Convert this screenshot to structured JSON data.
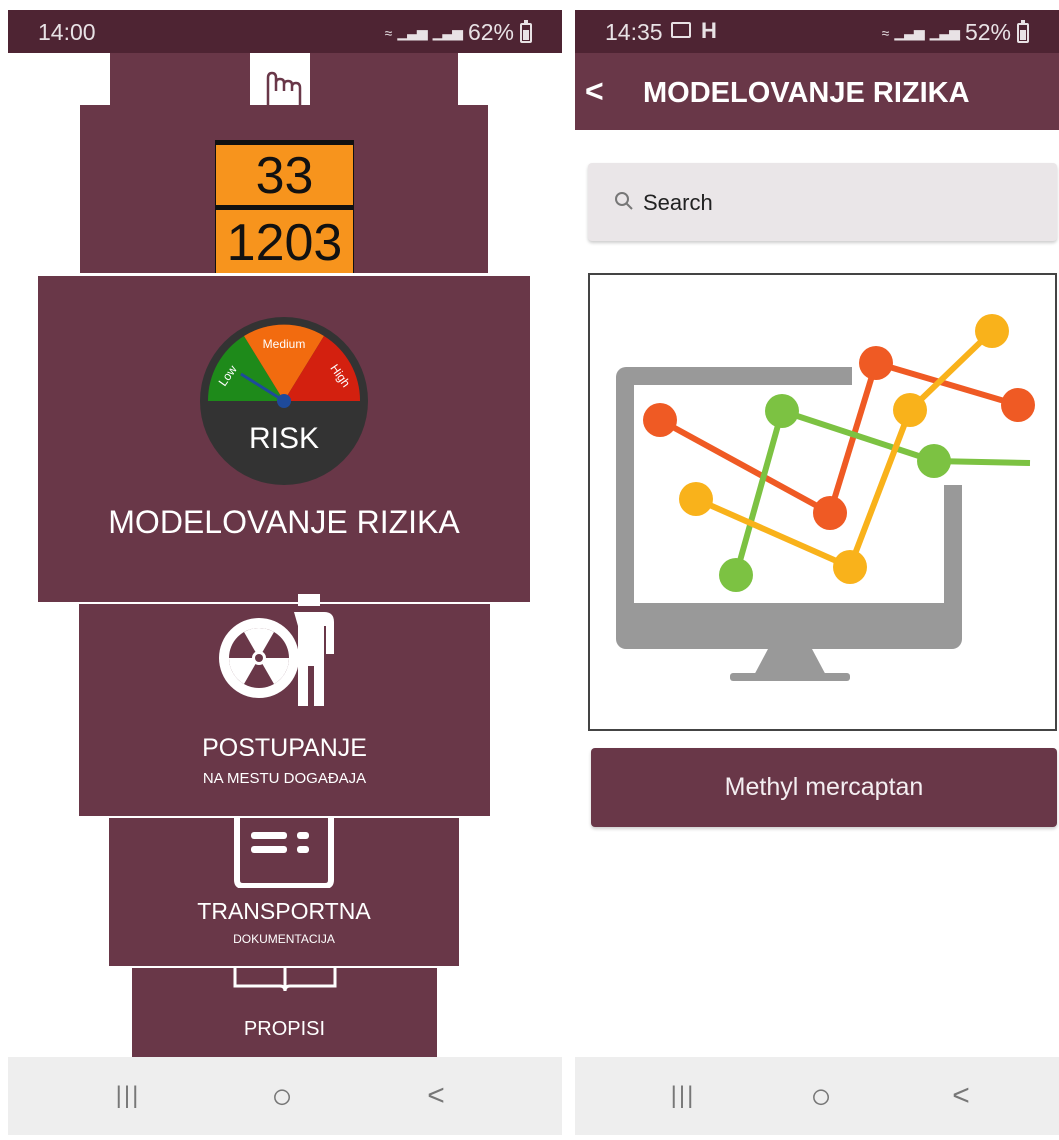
{
  "left_screen": {
    "status": {
      "time": "14:00",
      "battery_pct": "62%"
    },
    "hazard_plate": {
      "top_code": "33",
      "bottom_code": "1203"
    },
    "gauge": {
      "low": "Low",
      "medium": "Medium",
      "high": "High",
      "center_label": "RISK"
    },
    "cards": {
      "risk_modeling": {
        "label": "MODELOVANJE RIZIKA"
      },
      "procedure": {
        "label": "POSTUPANJE",
        "sublabel": "NA MESTU DOGAĐAJA"
      },
      "transport_docs": {
        "label": "TRANSPORTNA",
        "sublabel": "DOKUMENTACIJA"
      },
      "regulations": {
        "label": "PROPISI"
      }
    },
    "nav": {
      "recents": "|||",
      "home": "○",
      "back": "<"
    }
  },
  "right_screen": {
    "status": {
      "time": "14:35",
      "battery_pct": "52%"
    },
    "app_bar": {
      "back": "<",
      "title": "MODELOVANJE RIZIKA"
    },
    "search": {
      "placeholder": "Search"
    },
    "result": {
      "label": "Methyl mercaptan"
    },
    "nav": {
      "recents": "|||",
      "home": "○",
      "back": "<"
    }
  },
  "colors": {
    "status_bar": "#4e2433",
    "primary": "#693748",
    "plate_orange": "#f7941d",
    "gauge_low": "#1e8a1a",
    "gauge_medium": "#f26b0f",
    "gauge_high": "#d3200f",
    "dot_orange": "#ef5a24",
    "dot_green": "#7cc242",
    "dot_yellow": "#f9b21b",
    "monitor_gray": "#999999"
  }
}
